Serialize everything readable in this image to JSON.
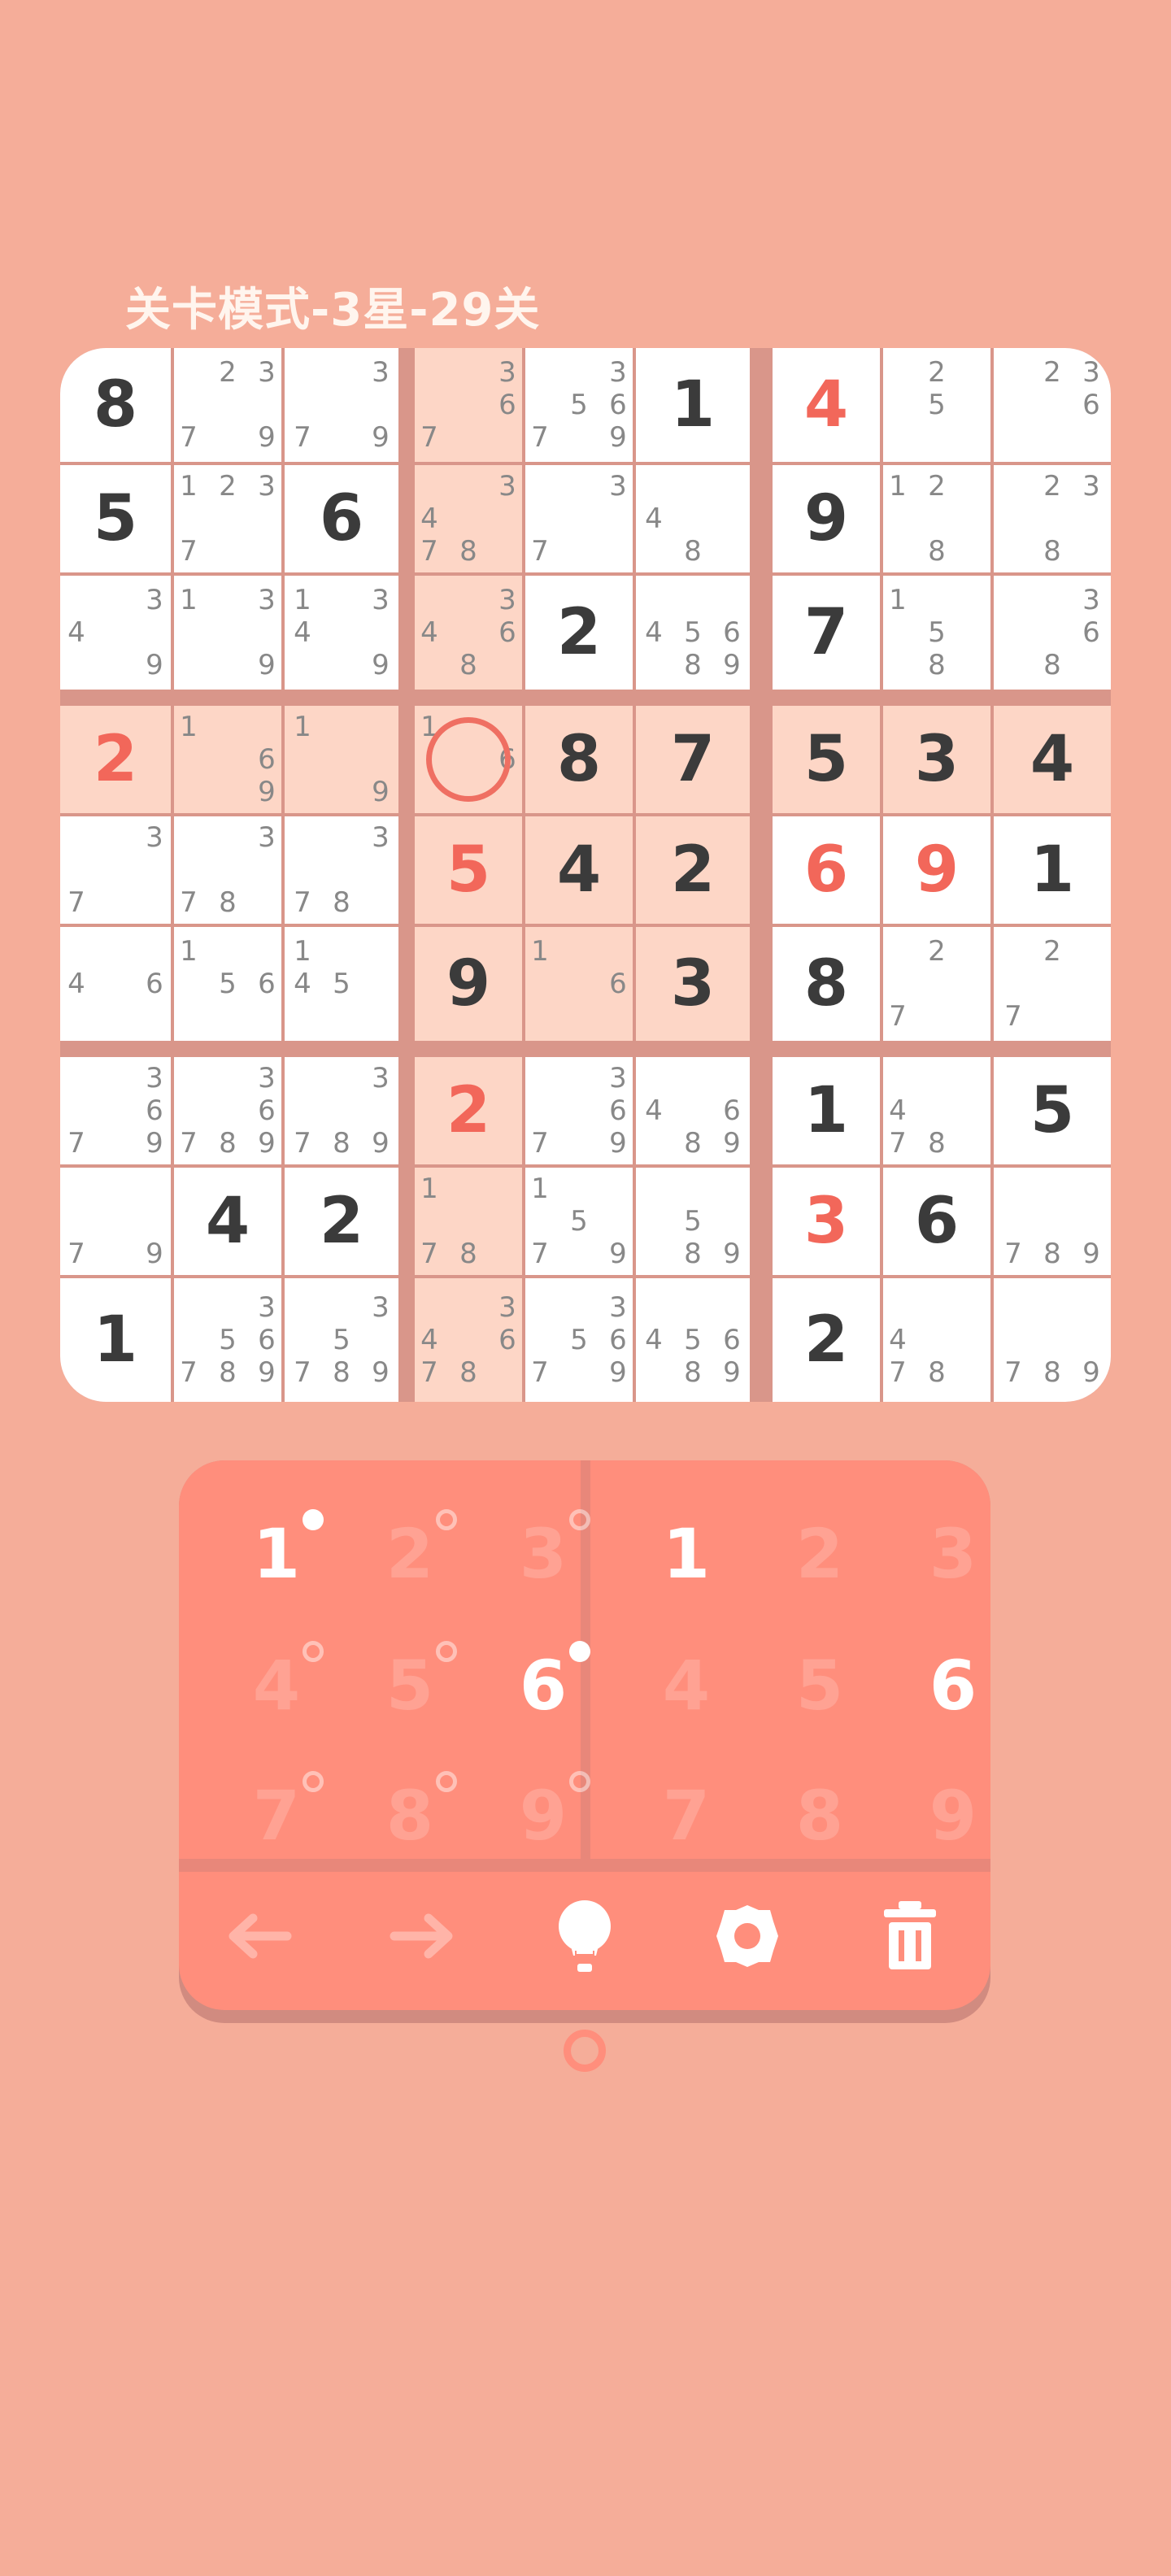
{
  "title": "关卡模式-3星-29关",
  "colors": {
    "background": "#f5ad99",
    "cell_white": "#ffffff",
    "cell_highlight": "#fdd6c6",
    "given_digit": "#3b3b3b",
    "user_digit": "#f2675a",
    "candidate": "#888888",
    "pad": "#ff8e7c"
  },
  "selected_cell": [
    3,
    3
  ],
  "highlighted_cells": [
    [
      0,
      3
    ],
    [
      1,
      3
    ],
    [
      2,
      3
    ],
    [
      3,
      0
    ],
    [
      3,
      1
    ],
    [
      3,
      2
    ],
    [
      3,
      3
    ],
    [
      3,
      4
    ],
    [
      3,
      5
    ],
    [
      3,
      6
    ],
    [
      3,
      7
    ],
    [
      3,
      8
    ],
    [
      4,
      3
    ],
    [
      4,
      4
    ],
    [
      4,
      5
    ],
    [
      5,
      3
    ],
    [
      5,
      4
    ],
    [
      5,
      5
    ],
    [
      6,
      3
    ],
    [
      7,
      3
    ],
    [
      8,
      3
    ]
  ],
  "grid": [
    [
      {
        "v": "8"
      },
      {
        "c": [
          2,
          3,
          7,
          9
        ]
      },
      {
        "c": [
          3,
          7,
          9
        ]
      },
      {
        "c": [
          3,
          6,
          7
        ]
      },
      {
        "c": [
          3,
          5,
          6,
          7,
          9
        ]
      },
      {
        "v": "1"
      },
      {
        "v": "4",
        "u": true
      },
      {
        "c": [
          2,
          5
        ]
      },
      {
        "c": [
          2,
          3,
          6
        ]
      }
    ],
    [
      {
        "v": "5"
      },
      {
        "c": [
          1,
          2,
          3,
          7
        ]
      },
      {
        "v": "6"
      },
      {
        "c": [
          3,
          4,
          7,
          8
        ]
      },
      {
        "c": [
          3,
          7
        ]
      },
      {
        "c": [
          4,
          8
        ]
      },
      {
        "v": "9"
      },
      {
        "c": [
          1,
          2,
          8
        ]
      },
      {
        "c": [
          2,
          3,
          8
        ]
      }
    ],
    [
      {
        "c": [
          3,
          4,
          9
        ]
      },
      {
        "c": [
          1,
          3,
          9
        ]
      },
      {
        "c": [
          1,
          3,
          4,
          9
        ]
      },
      {
        "c": [
          3,
          4,
          6,
          8
        ]
      },
      {
        "v": "2"
      },
      {
        "c": [
          4,
          5,
          6,
          8,
          9
        ]
      },
      {
        "v": "7"
      },
      {
        "c": [
          1,
          5,
          8
        ]
      },
      {
        "c": [
          3,
          6,
          8
        ]
      }
    ],
    [
      {
        "v": "2",
        "u": true
      },
      {
        "c": [
          1,
          6,
          9
        ]
      },
      {
        "c": [
          1,
          9
        ]
      },
      {
        "c": [
          1,
          6
        ]
      },
      {
        "v": "8"
      },
      {
        "v": "7"
      },
      {
        "v": "5"
      },
      {
        "v": "3"
      },
      {
        "v": "4"
      }
    ],
    [
      {
        "c": [
          3,
          7
        ]
      },
      {
        "c": [
          3,
          7,
          8
        ]
      },
      {
        "c": [
          3,
          7,
          8
        ]
      },
      {
        "v": "5",
        "u": true
      },
      {
        "v": "4"
      },
      {
        "v": "2"
      },
      {
        "v": "6",
        "u": true
      },
      {
        "v": "9",
        "u": true
      },
      {
        "v": "1"
      }
    ],
    [
      {
        "c": [
          4,
          6
        ]
      },
      {
        "c": [
          1,
          5,
          6
        ]
      },
      {
        "c": [
          1,
          4,
          5
        ]
      },
      {
        "v": "9"
      },
      {
        "c": [
          1,
          6
        ]
      },
      {
        "v": "3"
      },
      {
        "v": "8"
      },
      {
        "c": [
          2,
          7
        ]
      },
      {
        "c": [
          2,
          7
        ]
      }
    ],
    [
      {
        "c": [
          3,
          6,
          7,
          9
        ]
      },
      {
        "c": [
          3,
          6,
          7,
          8,
          9
        ]
      },
      {
        "c": [
          3,
          7,
          8,
          9
        ]
      },
      {
        "v": "2",
        "u": true
      },
      {
        "c": [
          3,
          6,
          7,
          9
        ]
      },
      {
        "c": [
          4,
          6,
          8,
          9
        ]
      },
      {
        "v": "1"
      },
      {
        "c": [
          4,
          7,
          8
        ]
      },
      {
        "v": "5"
      }
    ],
    [
      {
        "c": [
          7,
          9
        ]
      },
      {
        "v": "4"
      },
      {
        "v": "2"
      },
      {
        "c": [
          1,
          7,
          8
        ]
      },
      {
        "c": [
          1,
          5,
          7,
          9
        ]
      },
      {
        "c": [
          5,
          8,
          9
        ]
      },
      {
        "v": "3",
        "u": true
      },
      {
        "v": "6"
      },
      {
        "c": [
          7,
          8,
          9
        ]
      }
    ],
    [
      {
        "v": "1"
      },
      {
        "c": [
          3,
          5,
          6,
          7,
          8,
          9
        ]
      },
      {
        "c": [
          3,
          5,
          7,
          8,
          9
        ]
      },
      {
        "c": [
          3,
          4,
          6,
          7,
          8
        ]
      },
      {
        "c": [
          3,
          5,
          6,
          7,
          9
        ]
      },
      {
        "c": [
          4,
          5,
          6,
          8,
          9
        ]
      },
      {
        "v": "2"
      },
      {
        "c": [
          4,
          7,
          8
        ]
      },
      {
        "c": [
          7,
          8,
          9
        ]
      }
    ]
  ],
  "note_keys": [
    {
      "label": "1",
      "active": true
    },
    {
      "label": "2",
      "active": false
    },
    {
      "label": "3",
      "active": false
    },
    {
      "label": "4",
      "active": false
    },
    {
      "label": "5",
      "active": false
    },
    {
      "label": "6",
      "active": true
    },
    {
      "label": "7",
      "active": false
    },
    {
      "label": "8",
      "active": false
    },
    {
      "label": "9",
      "active": false
    }
  ],
  "number_keys": [
    {
      "label": "1",
      "active": true
    },
    {
      "label": "2",
      "active": false
    },
    {
      "label": "3",
      "active": false
    },
    {
      "label": "4",
      "active": false
    },
    {
      "label": "5",
      "active": false
    },
    {
      "label": "6",
      "active": true
    },
    {
      "label": "7",
      "active": false
    },
    {
      "label": "8",
      "active": false
    },
    {
      "label": "9",
      "active": false
    }
  ],
  "toolbar": [
    {
      "name": "undo-arrow-icon",
      "enabled": false
    },
    {
      "name": "redo-arrow-icon",
      "enabled": false
    },
    {
      "name": "hint-bulb-icon",
      "enabled": true
    },
    {
      "name": "settings-gear-icon",
      "enabled": true
    },
    {
      "name": "delete-trash-icon",
      "enabled": true
    }
  ]
}
